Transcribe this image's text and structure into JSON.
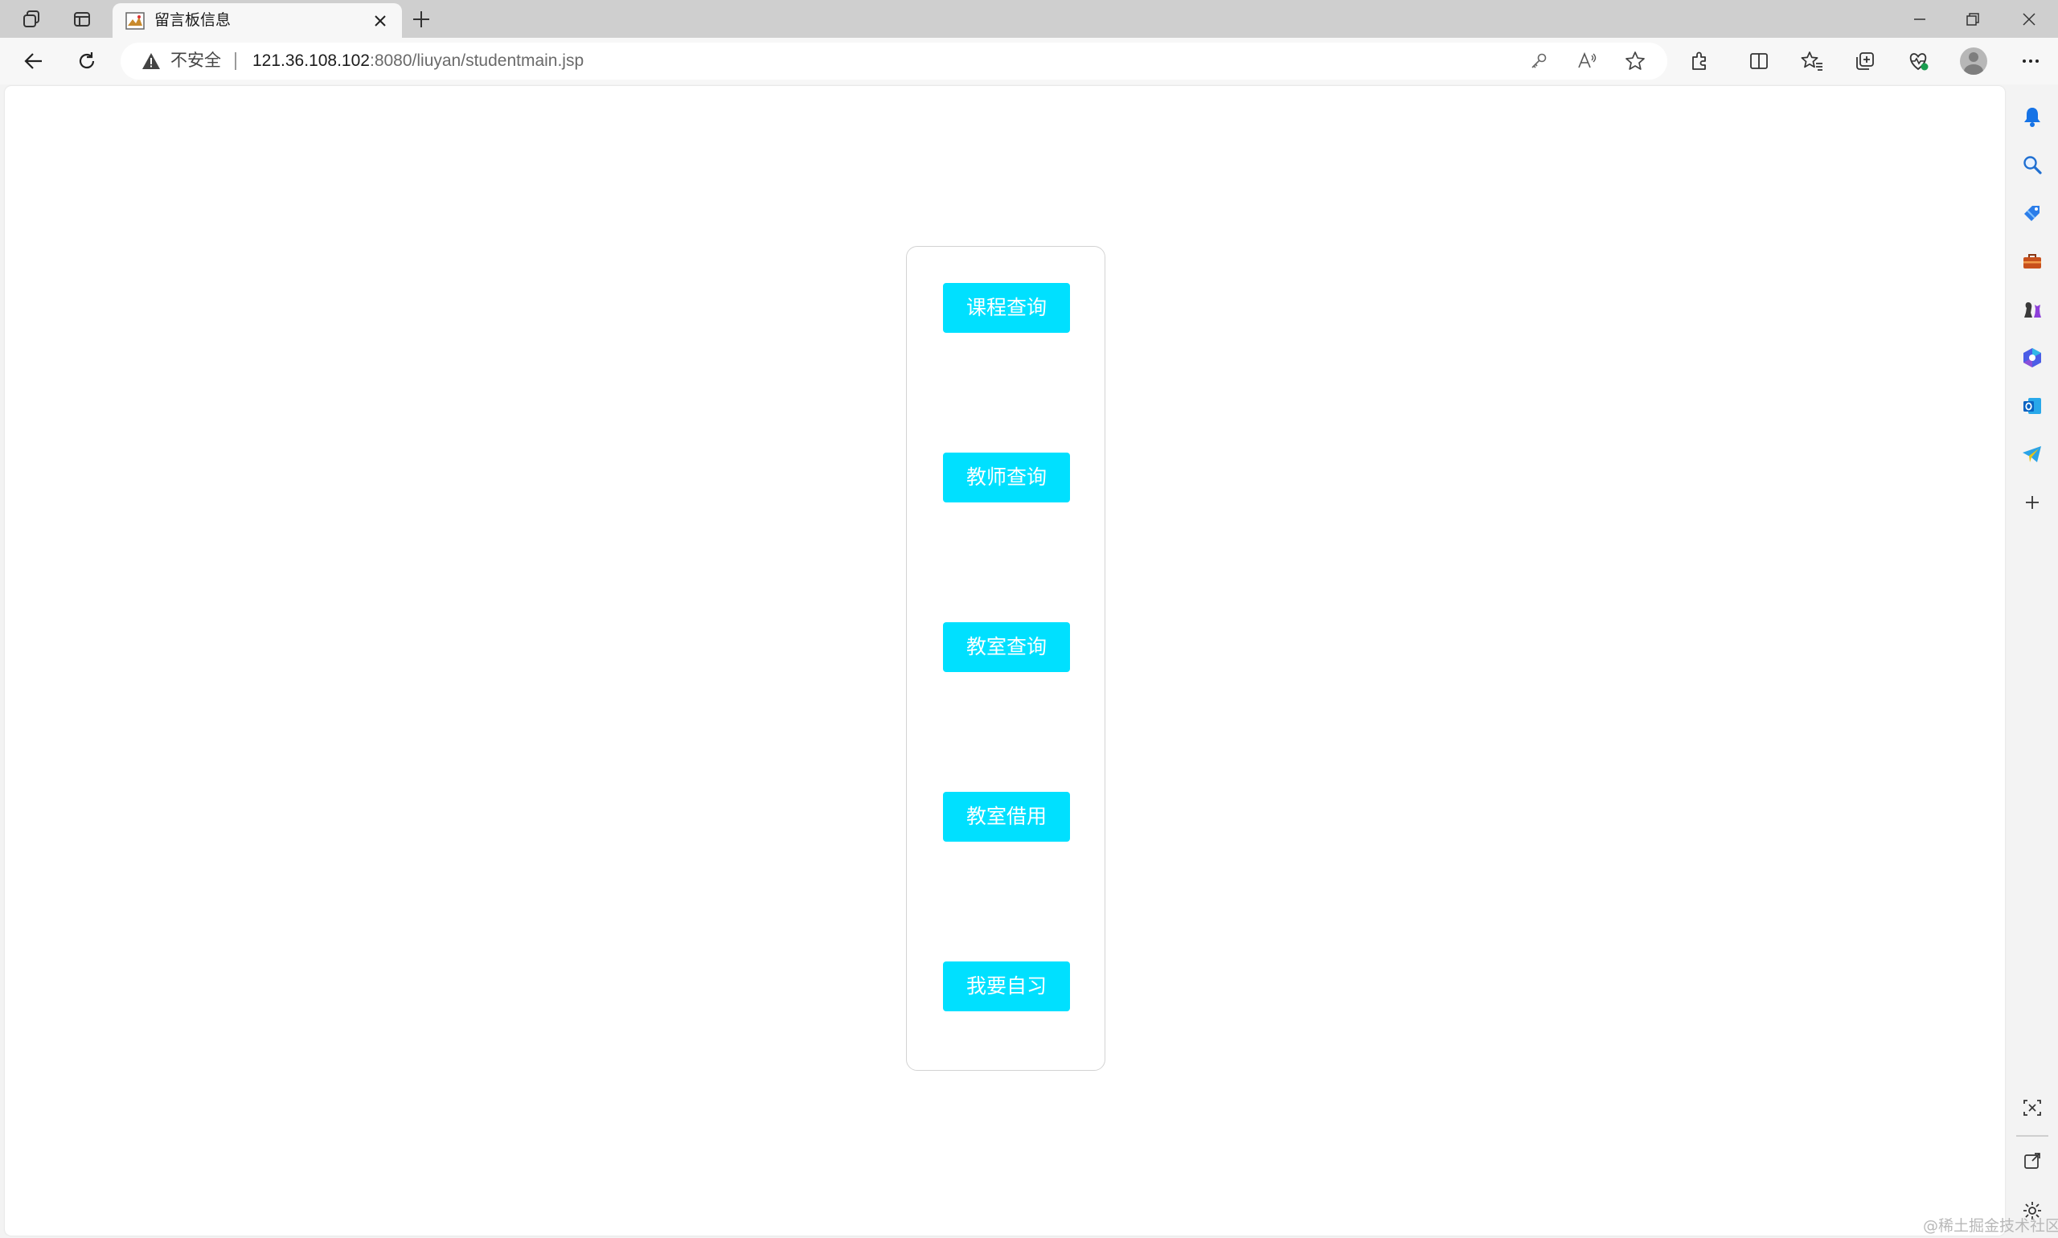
{
  "browser": {
    "tab": {
      "title": "留言板信息",
      "close_icon": "close-icon",
      "favicon": "page-favicon"
    },
    "address_bar": {
      "security_label": "不安全",
      "url_host": "121.36.108.102",
      "url_rest": ":8080/liuyan/studentmain.jsp"
    },
    "toolbar_icons": [
      "back-icon",
      "refresh-icon",
      "key-icon",
      "read-aloud-icon",
      "favorite-star-icon",
      "extensions-icon",
      "split-screen-icon",
      "favorites-icon",
      "collections-icon",
      "browser-essentials-icon",
      "profile-avatar",
      "more-icon"
    ],
    "sidebar_icons": [
      "bell-icon",
      "search-icon",
      "shopping-tag-icon",
      "toolbox-icon",
      "games-icon",
      "copilot-icon",
      "outlook-icon",
      "telegram-icon",
      "add-icon",
      "screenshot-icon",
      "open-external-icon",
      "settings-icon"
    ]
  },
  "colors": {
    "accent": "#00e0ff",
    "button_text": "#ffffff",
    "card_border": "#d3d3d3"
  },
  "menu": {
    "buttons": [
      {
        "label": "课程查询"
      },
      {
        "label": "教师查询"
      },
      {
        "label": "教室查询"
      },
      {
        "label": "教室借用"
      },
      {
        "label": "我要自习"
      }
    ]
  },
  "watermark": "@稀土掘金技术社区"
}
